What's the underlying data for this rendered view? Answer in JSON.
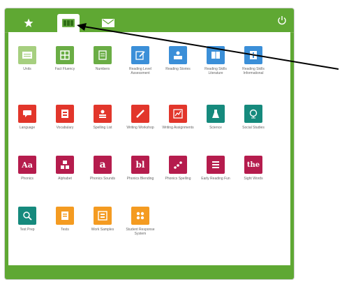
{
  "colors": {
    "frame": "#5fa833",
    "lightgreen": "#a6cf7f",
    "green": "#6aad45",
    "blue": "#3b8fd8",
    "red": "#e2362b",
    "teal": "#168a7d",
    "maroon": "#b51c4d",
    "orange": "#f49b21"
  },
  "tabs": [
    {
      "icon": "star-icon"
    },
    {
      "icon": "apps-grid-icon",
      "active": true
    },
    {
      "icon": "mail-icon"
    }
  ],
  "header": {
    "power_icon": "power-icon"
  },
  "rows": [
    [
      {
        "label": "Units",
        "color": "#a6cf7f",
        "icon": "folder-icon"
      },
      {
        "label": "Fact Fluency",
        "color": "#6aad45",
        "icon": "grid-icon"
      },
      {
        "label": "Numbers",
        "color": "#6aad45",
        "icon": "doc-icon"
      },
      {
        "label": "Reading Level Assessment",
        "color": "#3b8fd8",
        "icon": "pencil-doc-icon"
      },
      {
        "label": "Reading Stories",
        "color": "#3b8fd8",
        "icon": "reader-icon"
      },
      {
        "label": "Reading Skills Literature",
        "color": "#3b8fd8",
        "icon": "book-icon"
      },
      {
        "label": "Reading Skills Informational",
        "color": "#3b8fd8",
        "icon": "book-info-icon"
      }
    ],
    [
      {
        "label": "Language",
        "color": "#e2362b",
        "icon": "speech-icon"
      },
      {
        "label": "Vocabulary",
        "color": "#e2362b",
        "icon": "vocab-card-icon"
      },
      {
        "label": "Spelling List",
        "color": "#e2362b",
        "icon": "spelling-icon"
      },
      {
        "label": "Writing Workshop",
        "color": "#e2362b",
        "icon": "pen-icon"
      },
      {
        "label": "Writing Assignments",
        "color": "#e2362b",
        "icon": "chart-icon"
      },
      {
        "label": "Science",
        "color": "#168a7d",
        "icon": "flask-icon"
      },
      {
        "label": "Social Studies",
        "color": "#168a7d",
        "icon": "globe-icon"
      }
    ],
    [
      {
        "label": "Phonics",
        "color": "#b51c4d",
        "icon": "letters-icon",
        "glyph": "Aa"
      },
      {
        "label": "Alphabet",
        "color": "#b51c4d",
        "icon": "blocks-icon"
      },
      {
        "label": "Phonics Sounds",
        "color": "#b51c4d",
        "icon": "sound-letter-icon",
        "glyph": "a"
      },
      {
        "label": "Phonics Blending",
        "color": "#b51c4d",
        "icon": "blend-icon",
        "glyph": "bl"
      },
      {
        "label": "Phonics Spelling",
        "color": "#b51c4d",
        "icon": "phonics-spelling-icon"
      },
      {
        "label": "Early Reading Fun",
        "color": "#b51c4d",
        "icon": "list-icon"
      },
      {
        "label": "Sight Words",
        "color": "#b51c4d",
        "icon": "sight-words-icon",
        "glyph": "the"
      }
    ],
    [
      {
        "label": "Test Prep",
        "color": "#168a7d",
        "icon": "search-globe-icon"
      },
      {
        "label": "Tests",
        "color": "#f49b21",
        "icon": "test-doc-icon"
      },
      {
        "label": "Work Samples",
        "color": "#f49b21",
        "icon": "samples-icon"
      },
      {
        "label": "Student Response System",
        "color": "#f49b21",
        "icon": "response-icon"
      }
    ]
  ]
}
